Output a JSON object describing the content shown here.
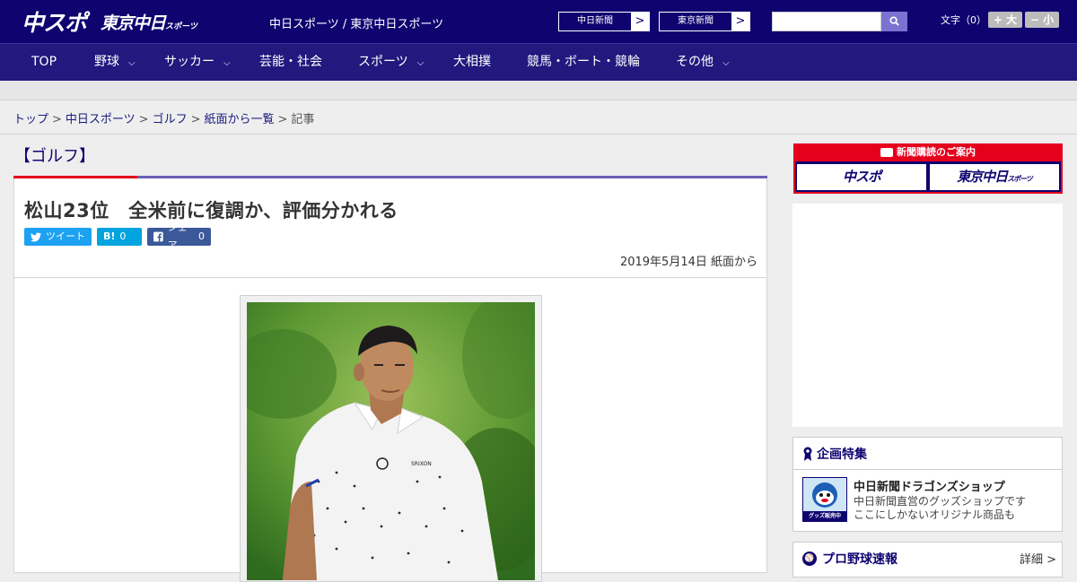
{
  "header": {
    "logo_chuspo": "中スポ",
    "logo_tokyo": "東京中日",
    "logo_tokyo_sub": "スポーツ",
    "site_name": "中日スポーツ / 東京中日スポーツ",
    "paper_links": [
      {
        "label": "中日新聞",
        "arrow": ">"
      },
      {
        "label": "東京新聞",
        "arrow": ">"
      }
    ],
    "search": {
      "placeholder": "",
      "icon": "search-icon"
    },
    "font_size": {
      "label": "文字（0）",
      "larger": "+ 大",
      "smaller": "− 小"
    }
  },
  "nav": {
    "items": [
      {
        "label": "TOP",
        "has_menu": false
      },
      {
        "label": "野球",
        "has_menu": true
      },
      {
        "label": "サッカー",
        "has_menu": true
      },
      {
        "label": "芸能・社会",
        "has_menu": false
      },
      {
        "label": "スポーツ",
        "has_menu": true
      },
      {
        "label": "大相撲",
        "has_menu": false
      },
      {
        "label": "競馬・ボート・競輪",
        "has_menu": false
      },
      {
        "label": "その他",
        "has_menu": true
      }
    ],
    "chevron": "⌵"
  },
  "breadcrumb": {
    "items": [
      "トップ",
      "中日スポーツ",
      "ゴルフ",
      "紙面から一覧"
    ],
    "current": "記事",
    "separator": ">"
  },
  "article": {
    "category": "【ゴルフ】",
    "headline": "松山23位　全米前に復調か、評価分かれる",
    "share": {
      "tweet_label": "ツイート",
      "hatena_label": "B!",
      "hatena_count": "0",
      "facebook_label": "シェア",
      "facebook_count": "0"
    },
    "date": "2019年5月14日 紙面から"
  },
  "sidebar": {
    "subscribe": {
      "title": "新聞購読のご案内",
      "chuspo": "中スポ",
      "tokyo": "東京中日",
      "tokyo_sub": "スポーツ"
    },
    "feature": {
      "title": "企画特集",
      "shop_title": "中日新聞ドラゴンズショップ",
      "shop_desc_1": "中日新聞直営のグッズショップです",
      "shop_desc_2": "ここにしかないオリジナル商品も",
      "shop_badge": "グッズ販売中"
    },
    "baseball": {
      "title": "プロ野球速報",
      "detail": "詳細 >"
    }
  },
  "colors": {
    "brand_navy": "#0f0370",
    "nav_bg": "#21197e",
    "accent_red": "#e5001c",
    "twitter": "#1da1f2",
    "hatena": "#00a4de",
    "facebook": "#3b5998"
  }
}
